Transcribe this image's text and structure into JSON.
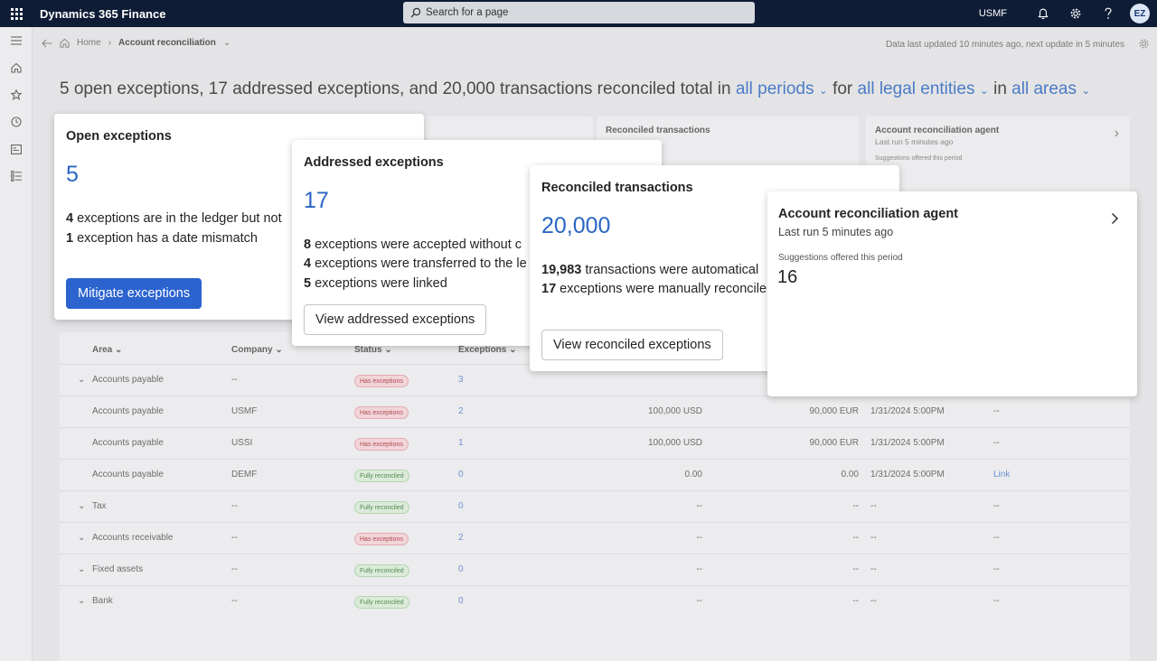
{
  "topbar": {
    "app_title": "Dynamics 365 Finance",
    "search_placeholder": "Search for a page",
    "company": "USMF",
    "avatar_initials": "EZ"
  },
  "breadcrumb": {
    "home": "Home",
    "current": "Account reconciliation"
  },
  "refresh_info": "Data last updated 10 minutes ago, next update in 5 minutes",
  "headline": {
    "text1": "5 open exceptions, 17 addressed exceptions, and 20,000 transactions reconciled total in",
    "period": "all periods",
    "for": "for",
    "entities": "all legal entities",
    "in": "in",
    "areas": "all areas"
  },
  "bg_cards": {
    "reconciled_title": "Reconciled transactions",
    "agent_title": "Account reconciliation agent",
    "agent_last_run": "Last run 5 minutes ago",
    "agent_suggestions": "Suggestions offered this period"
  },
  "table": {
    "columns": [
      "Area",
      "Company",
      "Status",
      "Exceptions"
    ],
    "rows": [
      {
        "area": "Accounts payable",
        "company": "--",
        "status": "Has exceptions",
        "status_type": "red",
        "exceptions": "3",
        "amount1": "",
        "amount2": "",
        "date": "",
        "link": "",
        "expand": true
      },
      {
        "area": "Accounts payable",
        "company": "USMF",
        "status": "Has exceptions",
        "status_type": "red",
        "exceptions": "2",
        "amount1": "100,000 USD",
        "amount2": "90,000 EUR",
        "date": "1/31/2024 5:00PM",
        "link": "--",
        "expand": false
      },
      {
        "area": "Accounts payable",
        "company": "USSI",
        "status": "Has exceptions",
        "status_type": "red",
        "exceptions": "1",
        "amount1": "100,000 USD",
        "amount2": "90,000 EUR",
        "date": "1/31/2024 5:00PM",
        "link": "--",
        "expand": false
      },
      {
        "area": "Accounts payable",
        "company": "DEMF",
        "status": "Fully reconciled",
        "status_type": "green",
        "exceptions": "0",
        "amount1": "0.00",
        "amount2": "0.00",
        "date": "1/31/2024 5:00PM",
        "link": "Link",
        "expand": false
      },
      {
        "area": "Tax",
        "company": "--",
        "status": "Fully reconciled",
        "status_type": "green",
        "exceptions": "0",
        "amount1": "--",
        "amount2": "--",
        "date": "--",
        "link": "--",
        "expand": true
      },
      {
        "area": "Accounts receivable",
        "company": "--",
        "status": "Has exceptions",
        "status_type": "red",
        "exceptions": "2",
        "amount1": "--",
        "amount2": "--",
        "date": "--",
        "link": "--",
        "expand": true
      },
      {
        "area": "Fixed assets",
        "company": "--",
        "status": "Fully reconciled",
        "status_type": "green",
        "exceptions": "0",
        "amount1": "--",
        "amount2": "--",
        "date": "--",
        "link": "--",
        "expand": true
      },
      {
        "area": "Bank",
        "company": "--",
        "status": "Fully reconciled",
        "status_type": "green",
        "exceptions": "0",
        "amount1": "--",
        "amount2": "--",
        "date": "--",
        "link": "--",
        "expand": true
      }
    ]
  },
  "cards": {
    "open": {
      "title": "Open exceptions",
      "value": "5",
      "line1_num": "4",
      "line1_text": " exceptions are in the ledger but not",
      "line2_num": "1",
      "line2_text": " exception has a date mismatch",
      "button": "Mitigate exceptions"
    },
    "addressed": {
      "title": "Addressed exceptions",
      "value": "17",
      "line1_num": "8",
      "line1_text": " exceptions were accepted without c",
      "line2_num": "4",
      "line2_text": " exceptions were transferred to the le",
      "line3_num": "5",
      "line3_text": " exceptions were linked",
      "button": "View addressed exceptions"
    },
    "reconciled": {
      "title": "Reconciled transactions",
      "value": "20,000",
      "line1_num": "19,983",
      "line1_text": " transactions were automatical",
      "line2_num": "17",
      "line2_text": " exceptions were manually reconcile",
      "button": "View reconciled exceptions"
    },
    "agent": {
      "title": "Account reconciliation agent",
      "last_run": "Last run 5 minutes ago",
      "suggestions_label": "Suggestions offered this period",
      "suggestions_value": "16"
    }
  }
}
